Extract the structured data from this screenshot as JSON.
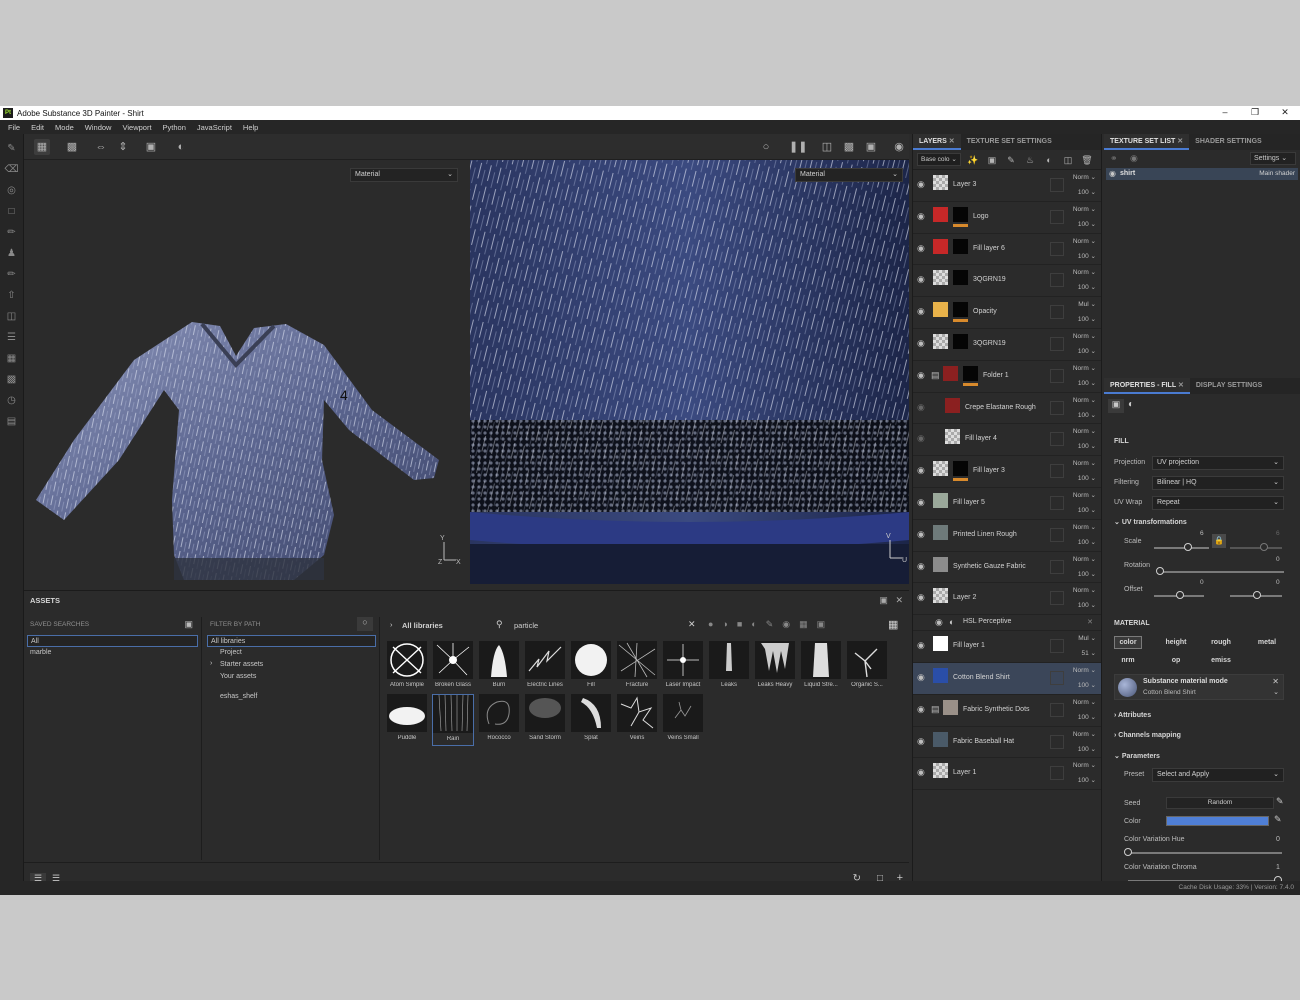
{
  "window": {
    "title": "Adobe Substance 3D Painter - Shirt",
    "logo": "Pt"
  },
  "menu": [
    "File",
    "Edit",
    "Mode",
    "Window",
    "Viewport",
    "Python",
    "JavaScript",
    "Help"
  ],
  "viewport": {
    "left_mode": "Material",
    "right_mode": "Material"
  },
  "assets": {
    "title": "ASSETS",
    "saved_searches_label": "SAVED SEARCHES",
    "saved_searches": [
      "All",
      "marble"
    ],
    "filter_label": "FILTER BY PATH",
    "filter_items": [
      "All libraries",
      "Project",
      "Starter assets",
      "Your assets",
      "eshas_shelf"
    ],
    "breadcrumb": "All libraries",
    "search_value": "particle",
    "thumbnails": [
      {
        "label": "Atom Simple"
      },
      {
        "label": "Broken Glass"
      },
      {
        "label": "Burn"
      },
      {
        "label": "Electric Lines"
      },
      {
        "label": "Fill"
      },
      {
        "label": "Fracture"
      },
      {
        "label": "Laser Impact"
      },
      {
        "label": "Leaks"
      },
      {
        "label": "Leaks Heavy"
      },
      {
        "label": "Liquid Stre..."
      },
      {
        "label": "Organic S..."
      },
      {
        "label": "Puddle"
      },
      {
        "label": "Rain"
      },
      {
        "label": "Rococco"
      },
      {
        "label": "Sand Storm"
      },
      {
        "label": "Splat"
      },
      {
        "label": "Veins"
      },
      {
        "label": "Veins Small"
      }
    ]
  },
  "layers_panel": {
    "tabs": [
      "LAYERS",
      "TEXTURE SET SETTINGS"
    ],
    "channel": "Base colo",
    "layers": [
      {
        "name": "Layer 3",
        "blend": "Norm",
        "opacity": "100"
      },
      {
        "name": "Logo",
        "blend": "Norm",
        "opacity": "100"
      },
      {
        "name": "Fill layer 6",
        "blend": "Norm",
        "opacity": "100"
      },
      {
        "name": "3QGRN19",
        "blend": "Norm",
        "opacity": "100"
      },
      {
        "name": "Opacity",
        "blend": "Mul",
        "opacity": "100"
      },
      {
        "name": "3QGRN19",
        "blend": "Norm",
        "opacity": "100"
      },
      {
        "name": "Folder 1",
        "blend": "Norm",
        "opacity": "100"
      },
      {
        "name": "Crepe Elastane Rough",
        "blend": "Norm",
        "opacity": "100"
      },
      {
        "name": "Fill layer 4",
        "blend": "Norm",
        "opacity": "100"
      },
      {
        "name": "Fill layer 3",
        "blend": "Norm",
        "opacity": "100"
      },
      {
        "name": "Fill layer 5",
        "blend": "Norm",
        "opacity": "100"
      },
      {
        "name": "Printed Linen Rough",
        "blend": "Norm",
        "opacity": "100"
      },
      {
        "name": "Synthetic Gauze Fabric",
        "blend": "Norm",
        "opacity": "100"
      },
      {
        "name": "Layer 2",
        "blend": "Norm",
        "opacity": "100"
      },
      {
        "name": "HSL Perceptive",
        "blend": "",
        "opacity": ""
      },
      {
        "name": "Fill layer 1",
        "blend": "Mul",
        "opacity": "51"
      },
      {
        "name": "Cotton Blend Shirt",
        "blend": "Norm",
        "opacity": "100"
      },
      {
        "name": "Fabric Synthetic Dots",
        "blend": "Norm",
        "opacity": "100"
      },
      {
        "name": "Fabric Baseball Hat",
        "blend": "Norm",
        "opacity": "100"
      },
      {
        "name": "Layer 1",
        "blend": "Norm",
        "opacity": "100"
      }
    ]
  },
  "texture_set": {
    "tabs": [
      "TEXTURE SET LIST",
      "SHADER SETTINGS"
    ],
    "settings_label": "Settings",
    "item_name": "shirt",
    "item_shader": "Main shader"
  },
  "properties": {
    "tabs": [
      "PROPERTIES - FILL",
      "DISPLAY SETTINGS"
    ],
    "fill_title": "FILL",
    "projection_label": "Projection",
    "projection_value": "UV projection",
    "filtering_label": "Filtering",
    "filtering_value": "Bilinear | HQ",
    "uvwrap_label": "UV Wrap",
    "uvwrap_value": "Repeat",
    "uvtrans_label": "UV transformations",
    "scale_label": "Scale",
    "scale_value": "6",
    "scale_value2": "6",
    "rotation_label": "Rotation",
    "rotation_value": "0",
    "offset_label": "Offset",
    "offset_value1": "0",
    "offset_value2": "0",
    "material_title": "MATERIAL",
    "channels": [
      "color",
      "height",
      "rough",
      "metal",
      "nrm",
      "op",
      "emiss"
    ],
    "material_mode_title": "Substance material mode",
    "material_name": "Cotton Blend Shirt",
    "attributes_label": "Attributes",
    "channels_mapping_label": "Channels mapping",
    "parameters_label": "Parameters",
    "preset_label": "Preset",
    "preset_value": "Select and Apply",
    "seed_label": "Seed",
    "seed_value": "Random",
    "color_label": "Color",
    "color_hex": "#4f7fd6",
    "hue_label": "Color Variation Hue",
    "hue_value": "0",
    "chroma_label": "Color Variation Chroma",
    "chroma_value": "1"
  },
  "status_text": "Cache Disk Usage:  33% | Version: 7.4.0"
}
